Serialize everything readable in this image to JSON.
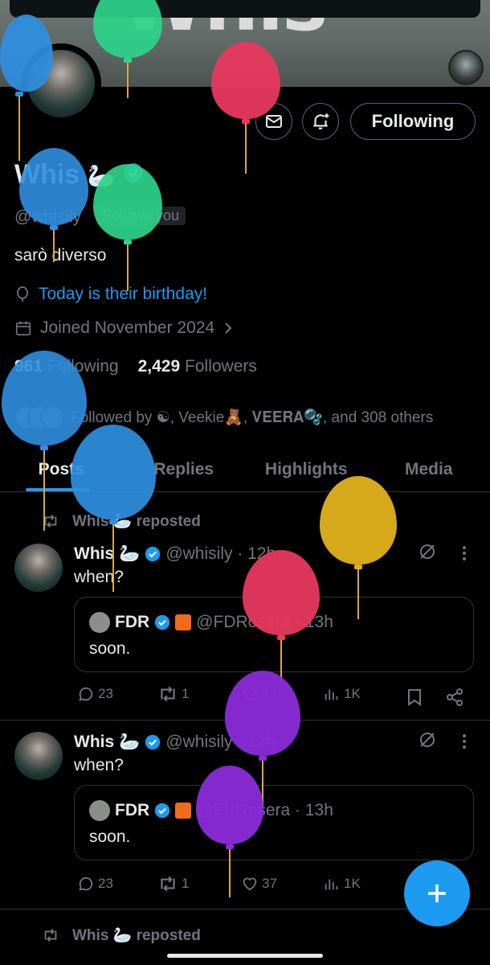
{
  "profile": {
    "banner_text": "Whis",
    "name": "Whis",
    "handle": "@whisily",
    "follows_you": "Follows you",
    "bio": "sarò diverso",
    "birthday": "Today is their birthday!",
    "joined": "Joined November 2024",
    "following_count": "961",
    "following_label": "Following",
    "followers_count": "2,429",
    "followers_label": "Followers",
    "followed_by": "Followed by ☯, Veekie🧸, 𝐕𝐄𝐄𝐑𝐀🫧, and 308 others"
  },
  "buttons": {
    "follow": "Following"
  },
  "tabs": [
    "Posts",
    "Replies",
    "Highlights",
    "Media"
  ],
  "posts": [
    {
      "repost_label": "Whis 🦢 reposted",
      "name": "Whis",
      "emoji": "🦢",
      "handle": "@whisily · 12h",
      "text": "when?",
      "quote": {
        "name": "FDR",
        "handle": "@FDRosera · 13h",
        "text": "soon."
      },
      "replies": "23",
      "reposts": "1",
      "likes": "37",
      "views": "1K"
    },
    {
      "name": "Whis",
      "emoji": "🦢",
      "handle": "@whisily · 12h",
      "text": "when?",
      "quote": {
        "name": "FDR",
        "handle": "@FDRosera · 13h",
        "text": "soon."
      },
      "replies": "23",
      "reposts": "1",
      "likes": "37",
      "views": "1K"
    }
  ],
  "next_repost": "Whis 🦢 reposted",
  "colors": {
    "accent": "#1d9bf0",
    "muted": "#71767b",
    "balloon_blue": "#2f8fe0",
    "balloon_green": "#2dd389",
    "balloon_red": "#e8385f",
    "balloon_yellow": "#e0b21a",
    "balloon_purple": "#8a2bd8"
  }
}
